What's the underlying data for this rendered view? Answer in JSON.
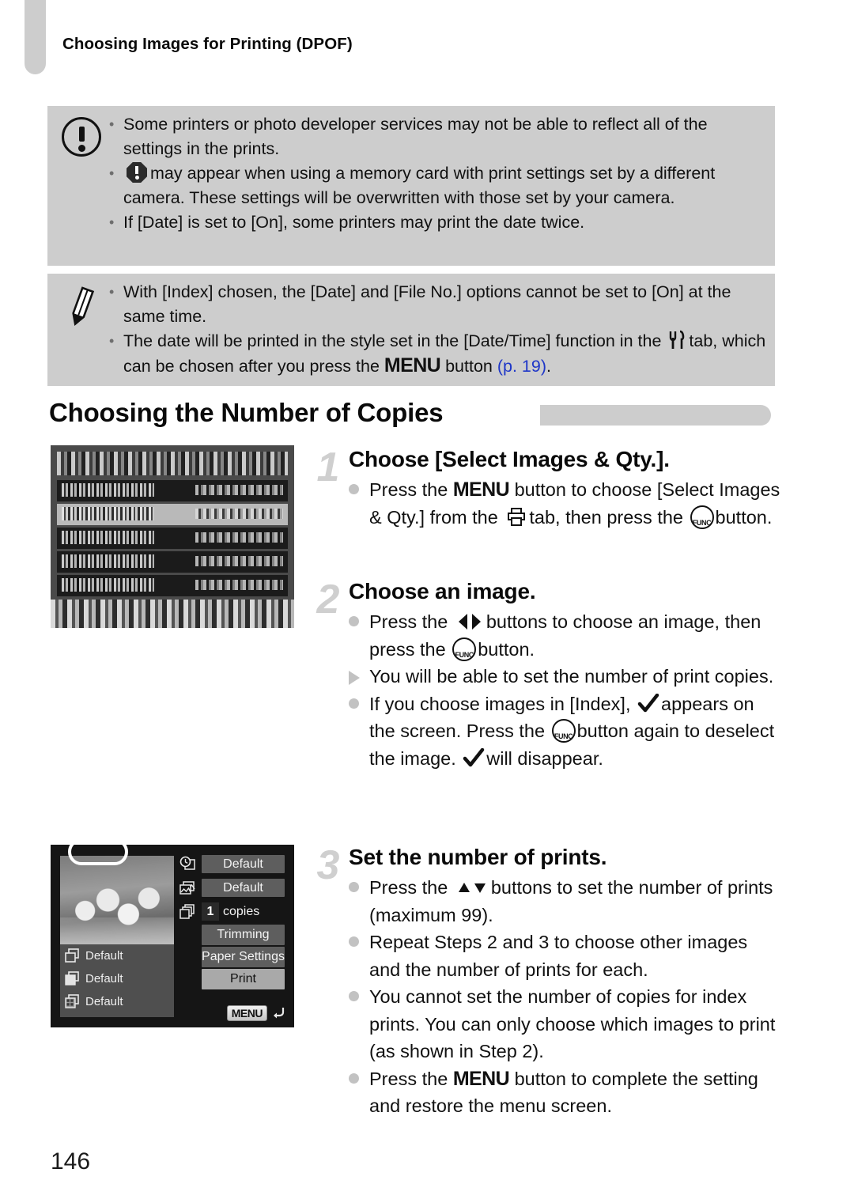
{
  "page": {
    "running_header": "Choosing Images for Printing (DPOF)",
    "page_number": "146",
    "accent_link_color": "#1f37c8",
    "callout_bg": "#cdcdcd"
  },
  "warning_box": {
    "icon": "exclamation-circle-icon",
    "bullets": [
      {
        "pre": "Some printers or photo developer services may not be able to reflect all of the settings in the prints.",
        "post": ""
      },
      {
        "pre": "",
        "inline_icon": "exclamation-octagon-icon",
        "post": "may appear when using a memory card with print settings set by a different camera. These settings will be overwritten with those set by your camera."
      },
      {
        "pre": "If [Date] is set to [On], some printers may print the date twice.",
        "post": ""
      }
    ]
  },
  "note_box": {
    "icon": "pencil-icon",
    "bullet_1": "With [Index] chosen, the [Date] and [File No.] options cannot be set to [On] at the same time.",
    "bullet_2_part1": "The date will be printed in the style set in the [Date/Time] function in the",
    "bullet_2_tools_icon": "settings-tools-tab-icon",
    "bullet_2_part2": "tab, which can be chosen after you press the",
    "bullet_2_menu": "MENU",
    "bullet_2_part3": "button",
    "bullet_2_ref": "(p. 19)",
    "bullet_2_end": "."
  },
  "section": {
    "title": "Choosing the Number of Copies"
  },
  "steps": [
    {
      "number": "1",
      "title": "Choose [Select Images & Qty.].",
      "bullets": [
        {
          "marker": "round",
          "p1": "Press the",
          "menu": "MENU",
          "p2": "button to choose [Select Images & Qty.] from the",
          "printer_icon": "print-tab-icon",
          "p3": "tab, then press the",
          "func_icon": "func-set-button-icon",
          "p4": "button."
        }
      ]
    },
    {
      "number": "2",
      "title": "Choose an image.",
      "bullets": [
        {
          "marker": "round",
          "p1": "Press the",
          "lr_icon": "left-right-buttons-icon",
          "p2": "buttons to choose an image, then press the",
          "func_icon": "func-set-button-icon",
          "p3": "button."
        },
        {
          "marker": "triangle",
          "p1": "You will be able to set the number of print copies."
        },
        {
          "marker": "round",
          "p1": "If you choose images in [Index],",
          "check_icon": "checkmark-icon",
          "p2": "appears on the screen. Press the",
          "func_icon": "func-set-button-icon",
          "p3": "button again to deselect the image.",
          "check_icon_2": "checkmark-icon",
          "p4": "will disappear."
        }
      ]
    },
    {
      "number": "3",
      "title": "Set the number of prints.",
      "bullets": [
        {
          "marker": "round",
          "p1": "Press the",
          "ud_icon": "up-down-buttons-icon",
          "p2": "buttons to set the number of prints (maximum 99)."
        },
        {
          "marker": "round",
          "p1": "Repeat Steps 2 and 3 to choose other images and the number of prints for each."
        },
        {
          "marker": "round",
          "p1": "You cannot set the number of copies for index prints. You can only choose which images to print (as shown in Step 2)."
        },
        {
          "marker": "round",
          "p1": "Press the",
          "menu": "MENU",
          "p2": "button to complete the setting and restore the menu screen."
        }
      ]
    }
  ],
  "figure_menu": {
    "name": "dpof-menu-screen",
    "rows": 5
  },
  "figure_print_settings": {
    "name": "print-settings-screen",
    "left_items": [
      {
        "icon": "paper-size-icon",
        "label": "Default"
      },
      {
        "icon": "paper-type-icon",
        "label": "Default"
      },
      {
        "icon": "page-layout-icon",
        "label": "Default"
      }
    ],
    "right_rows": [
      {
        "icon": "date-stamp-icon",
        "value": "Default"
      },
      {
        "icon": "file-no-icon",
        "value": "Default"
      },
      {
        "icon": "copies-icon",
        "count": "1",
        "unit": "copies"
      }
    ],
    "buttons": [
      {
        "label": "Trimming",
        "highlighted": false
      },
      {
        "label": "Paper Settings",
        "highlighted": false
      },
      {
        "label": "Print",
        "highlighted": true
      }
    ],
    "menu_badge": "MENU",
    "return_icon": "return-arrow-icon"
  }
}
